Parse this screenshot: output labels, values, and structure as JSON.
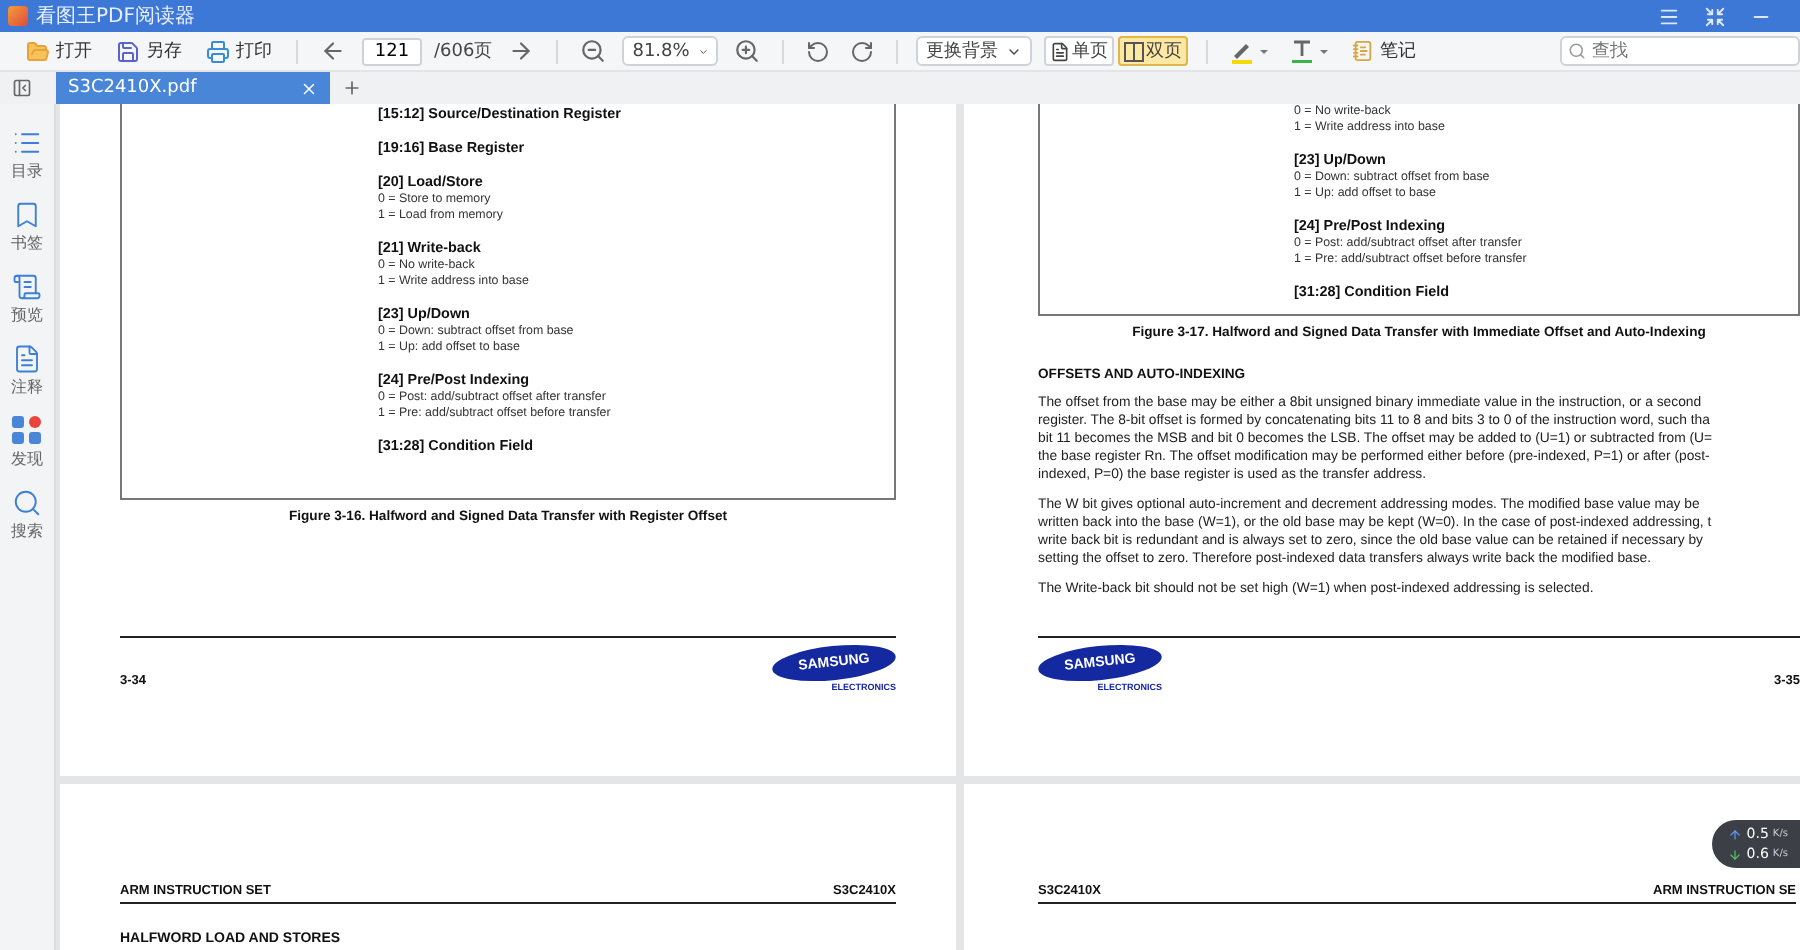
{
  "window": {
    "title": "看图王PDF阅读器"
  },
  "toolbar": {
    "file_buttons": [
      {
        "kind": "open",
        "label": "打开"
      },
      {
        "kind": "save",
        "label": "另存"
      },
      {
        "kind": "print",
        "label": "打印"
      }
    ],
    "page": {
      "value": "121",
      "total": "/606页"
    },
    "zoom": {
      "value": "81.8%"
    },
    "background": {
      "label": "更换背景"
    },
    "view_modes": [
      {
        "kind": "single",
        "label": "单页",
        "selected": false
      },
      {
        "kind": "double",
        "label": "双页",
        "selected": true
      }
    ],
    "note": {
      "label": "笔记"
    },
    "search": {
      "placeholder": "查找"
    }
  },
  "tabs": [
    {
      "label": "S3C2410X.pdf",
      "selected": true
    }
  ],
  "sidebar": {
    "items": [
      {
        "kind": "toc",
        "label": "目录"
      },
      {
        "kind": "bookmark",
        "label": "书签"
      },
      {
        "kind": "preview",
        "label": "预览"
      },
      {
        "kind": "annotation",
        "label": "注释"
      },
      {
        "kind": "discover",
        "label": "发现"
      },
      {
        "kind": "search",
        "label": "搜索"
      }
    ]
  },
  "pages": [
    {
      "kind": "left",
      "fields": [
        {
          "title": "[15:12] Source/Destination Register"
        },
        {
          "title": "[19:16] Base Register"
        },
        {
          "title": "[20] Load/Store",
          "lines": [
            "0 = Store to memory",
            "1 = Load from memory"
          ]
        },
        {
          "title": "[21] Write-back",
          "lines": [
            "0 = No write-back",
            "1 = Write address into base"
          ]
        },
        {
          "title": "[23] Up/Down",
          "lines": [
            "0 = Down: subtract offset from base",
            "1 = Up: add offset to base"
          ]
        },
        {
          "title": "[24] Pre/Post Indexing",
          "lines": [
            "0 = Post: add/subtract offset after transfer",
            "1 = Pre: add/subtract offset before transfer"
          ]
        },
        {
          "title": "[31:28] Condition Field"
        }
      ],
      "caption": "Figure 3-16. Halfword and Signed Data Transfer with Register Offset",
      "footer": {
        "page_number": "3-34",
        "logo": "SAMSUNG",
        "logo_sub": "ELECTRONICS"
      }
    },
    {
      "kind": "right",
      "fields": [
        {
          "lines": [
            "0 = No write-back",
            "1 = Write address into base"
          ]
        },
        {
          "title": "[23] Up/Down",
          "lines": [
            "0 = Down: subtract offset from base",
            "1 = Up: add offset to base"
          ]
        },
        {
          "title": "[24] Pre/Post Indexing",
          "lines": [
            "0 = Post: add/subtract offset after transfer",
            "1 = Pre: add/subtract offset before transfer"
          ]
        },
        {
          "title": "[31:28] Condition Field"
        }
      ],
      "caption": "Figure 3-17. Halfword and Signed Data Transfer with Immediate Offset and Auto-Indexing",
      "heading": "OFFSETS AND AUTO-INDEXING",
      "paragraphs": [
        {
          "lines": [
            "The offset from the base may be either a 8bit unsigned binary immediate value in the instruction, or a second",
            "register. The 8-bit offset is formed by concatenating bits 11 to 8 and bits 3 to 0 of the instruction word, such tha",
            "bit 11 becomes the MSB and bit 0 becomes the LSB. The offset may be added to (U=1) or subtracted from (U=",
            "the base register Rn. The offset modification may be performed either before (pre-indexed, P=1) or after (post-",
            "indexed, P=0) the base register is used as the transfer address."
          ]
        },
        {
          "lines": [
            "The W bit gives optional auto-increment and decrement addressing modes. The modified base value may be",
            "written back into the base (W=1), or the old base may be kept (W=0). In the case of post-indexed addressing, t",
            "write back bit is redundant and is always set to zero, since the old base value can be retained if necessary by",
            "setting the offset to zero. Therefore post-indexed data transfers always write back the modified base."
          ]
        },
        {
          "lines": [
            "The Write-back bit should not be set high (W=1) when post-indexed addressing is selected."
          ]
        }
      ],
      "footer": {
        "page_number": "3-35",
        "logo": "SAMSUNG",
        "logo_sub": "ELECTRONICS"
      }
    }
  ],
  "next_pages": [
    {
      "kind": "left",
      "header": {
        "left": "ARM INSTRUCTION SET",
        "right": "S3C2410X"
      },
      "heading": "HALFWORD LOAD AND STORES"
    },
    {
      "kind": "right",
      "header": {
        "left": "S3C2410X",
        "right": "ARM INSTRUCTION SE"
      }
    }
  ],
  "network_widget": {
    "rows": [
      {
        "kind": "up",
        "value": "0.5",
        "unit": "K/s"
      },
      {
        "kind": "down",
        "value": "0.6",
        "unit": "K/s"
      }
    ]
  }
}
